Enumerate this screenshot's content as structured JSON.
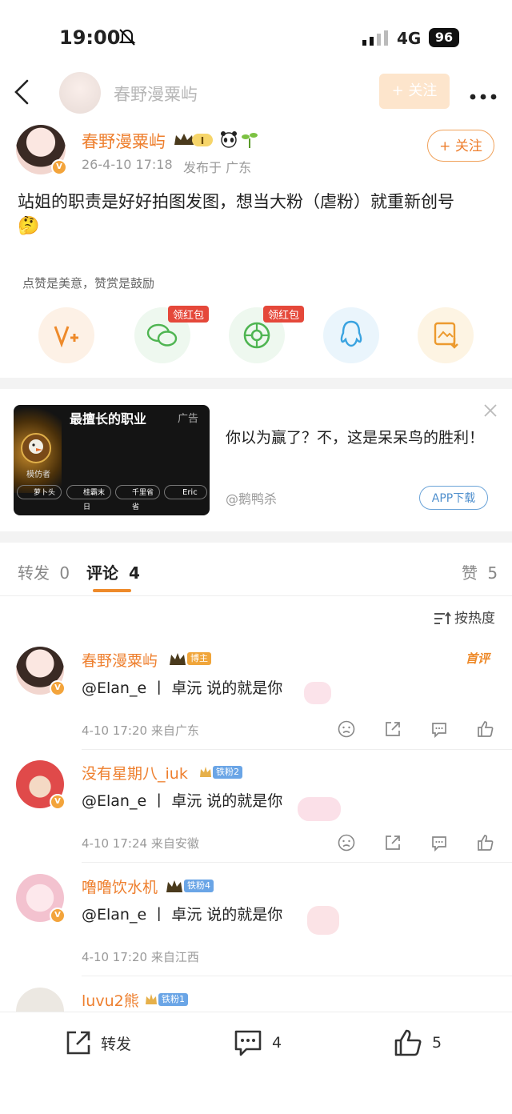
{
  "status": {
    "time": "19:00",
    "network": "4G",
    "battery": "96"
  },
  "header": {
    "title": "春野漫粟屿",
    "follow_label": "+ 关注"
  },
  "post": {
    "author": "春野漫粟屿",
    "level_badge": "I",
    "date": "26-4-10 17:18",
    "location": "发布于 广东",
    "follow_label": "+ 关注",
    "text": "站姐的职责是好好拍图发图，想当大粉（虐粉）就重新创号",
    "emoji": "🤔",
    "reward_hint": "点赞是美意，赞赏是鼓励"
  },
  "share": {
    "items": [
      {
        "name": "vplus",
        "glyph": "V+",
        "tag": ""
      },
      {
        "name": "wechat",
        "glyph": "",
        "tag": "领红包"
      },
      {
        "name": "moments",
        "glyph": "",
        "tag": "领红包"
      },
      {
        "name": "qq",
        "glyph": "",
        "tag": ""
      },
      {
        "name": "save-image",
        "glyph": "",
        "tag": ""
      }
    ]
  },
  "ad": {
    "image_title": "最擅长的职业",
    "ad_label": "广告",
    "role": "模仿者",
    "players": [
      "萝卜头",
      "桂霸末日",
      "千里省省",
      "Eric"
    ],
    "text": "你以为赢了？不，这是呆呆鸟的胜利！",
    "source": "@鹅鸭杀",
    "download_label": "APP下载"
  },
  "tabs": {
    "repost_label": "转发",
    "repost_count": "0",
    "comment_label": "评论",
    "comment_count": "4",
    "like_label": "赞",
    "like_count": "5"
  },
  "sort_label": "按热度",
  "comments": [
    {
      "name": "春野漫粟屿",
      "badge": "博主",
      "pin": "首评",
      "text": "@Elan_e 丨 卓沅 说的就是你",
      "time": "4-10 17:20",
      "loc": "来自广东"
    },
    {
      "name": "没有星期八_iuk",
      "badge": "铁粉2",
      "pin": "",
      "text": "@Elan_e 丨 卓沅 说的就是你",
      "time": "4-10 17:24",
      "loc": "来自安徽"
    },
    {
      "name": "噜噜饮水机",
      "badge": "铁粉4",
      "pin": "",
      "text": "@Elan_e 丨 卓沅 说的就是你",
      "time": "4-10 17:20",
      "loc": "来自江西"
    },
    {
      "name": "luvu2熊",
      "badge": "铁粉1",
      "pin": "",
      "text": "",
      "time": "",
      "loc": ""
    }
  ],
  "bottom_bar": {
    "repost_label": "转发",
    "comment_count": "4",
    "like_count": "5"
  },
  "colors": {
    "accent": "#ee7f2e",
    "tag_red": "#e5483a",
    "fan_badge": "#6aa5e6"
  }
}
